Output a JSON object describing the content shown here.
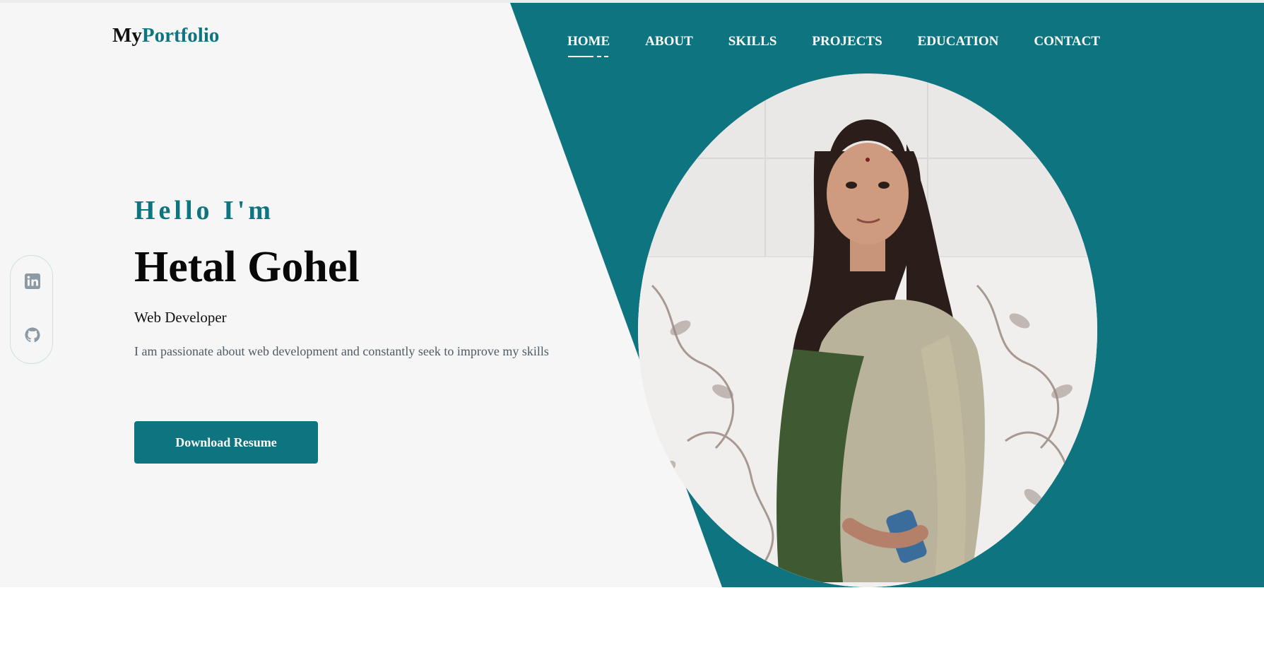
{
  "logo": {
    "prefix": "My",
    "accent": "Portfolio"
  },
  "nav": {
    "items": [
      {
        "label": "HOME",
        "active": true
      },
      {
        "label": "ABOUT"
      },
      {
        "label": "SKILLS"
      },
      {
        "label": "PROJECTS"
      },
      {
        "label": "EDUCATION"
      },
      {
        "label": "CONTACT"
      }
    ]
  },
  "social": {
    "icons": [
      "linkedin-icon",
      "github-icon"
    ]
  },
  "hero": {
    "greeting": "Hello I'm",
    "name": "Hetal Gohel",
    "role": "Web Developer",
    "description": "I am passionate about web development and constantly seek to improve my skills",
    "cta": "Download Resume"
  },
  "colors": {
    "accent": "#0e7480",
    "background": "#f6f6f6",
    "text": "#080808",
    "muted": "#4d5a66"
  }
}
